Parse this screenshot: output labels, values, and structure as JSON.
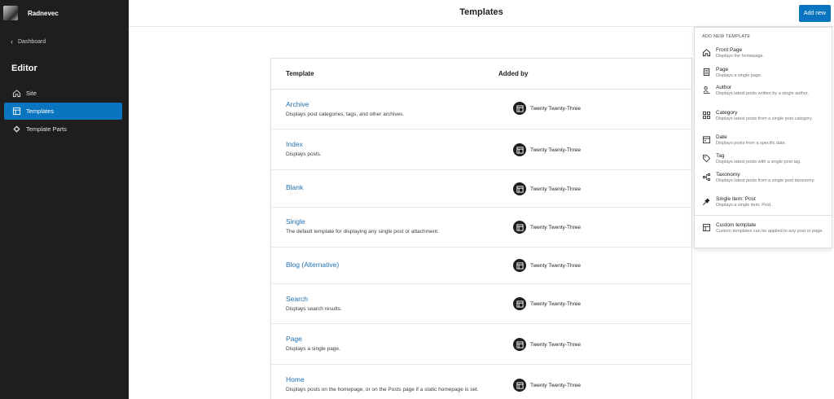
{
  "sidebar": {
    "site_name": "Radnevec",
    "back_label": "Dashboard",
    "editor_title": "Editor",
    "items": [
      {
        "label": "Site",
        "icon": "home-icon"
      },
      {
        "label": "Templates",
        "icon": "layout-icon",
        "active": true
      },
      {
        "label": "Template Parts",
        "icon": "symbol-icon"
      }
    ]
  },
  "header": {
    "title": "Templates",
    "add_new_label": "Add new"
  },
  "table": {
    "columns": [
      "Template",
      "Added by"
    ],
    "rows": [
      {
        "title": "Archive",
        "desc": "Displays post categories, tags, and other archives.",
        "author": "Twenty Twenty-Three"
      },
      {
        "title": "Index",
        "desc": "Displays posts.",
        "author": "Twenty Twenty-Three"
      },
      {
        "title": "Blank",
        "desc": "",
        "author": "Twenty Twenty-Three"
      },
      {
        "title": "Single",
        "desc": "The default template for displaying any single post or attachment.",
        "author": "Twenty Twenty-Three"
      },
      {
        "title": "Blog (Alternative)",
        "desc": "",
        "author": "Twenty Twenty-Three"
      },
      {
        "title": "Search",
        "desc": "Displays search results.",
        "author": "Twenty Twenty-Three"
      },
      {
        "title": "Page",
        "desc": "Displays a single page.",
        "author": "Twenty Twenty-Three"
      },
      {
        "title": "Home",
        "desc": "Displays posts on the homepage, or on the Posts page if a static homepage is set.",
        "author": "Twenty Twenty-Three"
      }
    ]
  },
  "dropdown": {
    "heading": "ADD NEW TEMPLATE",
    "items": [
      {
        "label": "Front Page",
        "desc": "Displays the homepage.",
        "icon": "home-icon"
      },
      {
        "label": "Page",
        "desc": "Displays a single page.",
        "icon": "page-icon"
      },
      {
        "label": "Author",
        "desc": "Displays latest posts written by a single author.",
        "icon": "author-icon"
      },
      {
        "label": "Category",
        "desc": "Displays latest posts from a single post category.",
        "icon": "category-icon"
      },
      {
        "label": "Date",
        "desc": "Displays posts from a specific date.",
        "icon": "calendar-icon"
      },
      {
        "label": "Tag",
        "desc": "Displays latest posts with a single post tag.",
        "icon": "tag-icon"
      },
      {
        "label": "Taxonomy",
        "desc": "Displays latest posts from a single post taxonomy.",
        "icon": "taxonomy-icon"
      },
      {
        "label": "Single item: Post",
        "desc": "Displays a single item: Post.",
        "icon": "pin-icon"
      },
      {
        "label": "Custom template",
        "desc": "Custom templates can be applied to any post or page.",
        "icon": "layout-icon"
      }
    ]
  },
  "colors": {
    "accent": "#0a75bf",
    "link": "#2271b1",
    "sidebar_bg": "#1e1e1e"
  }
}
